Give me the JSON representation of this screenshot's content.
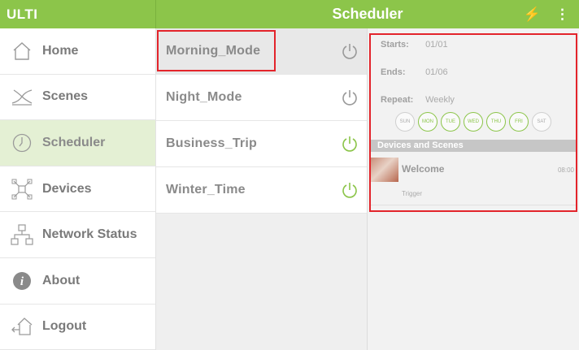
{
  "app": {
    "title": "ULTI"
  },
  "header": {
    "title": "Scheduler",
    "actions": [
      {
        "icon": "lightning-icon",
        "glyph": "⚡"
      },
      {
        "icon": "more-vertical-icon",
        "glyph": "⋮"
      }
    ]
  },
  "sidebar": {
    "items": [
      {
        "label": "Home",
        "icon": "home-icon"
      },
      {
        "label": "Scenes",
        "icon": "scenes-icon"
      },
      {
        "label": "Scheduler",
        "icon": "clock-icon",
        "active": true
      },
      {
        "label": "Devices",
        "icon": "devices-icon"
      },
      {
        "label": "Network Status",
        "icon": "network-icon"
      },
      {
        "label": "About",
        "icon": "info-icon"
      },
      {
        "label": "Logout",
        "icon": "logout-icon"
      }
    ]
  },
  "modes": {
    "items": [
      {
        "label": "Morning_Mode",
        "power": "off",
        "selected": true
      },
      {
        "label": "Night_Mode",
        "power": "off"
      },
      {
        "label": "Business_Trip",
        "power": "on"
      },
      {
        "label": "Winter_Time",
        "power": "on"
      }
    ]
  },
  "detail": {
    "starts_label": "Starts:",
    "starts_value": "01/01",
    "ends_label": "Ends:",
    "ends_value": "01/06",
    "repeat_label": "Repeat:",
    "repeat_value": "Weekly",
    "days": [
      {
        "label": "SUN",
        "on": false
      },
      {
        "label": "MON",
        "on": true
      },
      {
        "label": "TUE",
        "on": true
      },
      {
        "label": "WED",
        "on": true
      },
      {
        "label": "THU",
        "on": true
      },
      {
        "label": "FRI",
        "on": true
      },
      {
        "label": "SAT",
        "on": false
      }
    ],
    "section_title": "Devices and Scenes",
    "scene": {
      "name": "Welcome",
      "time": "08:00",
      "trigger": "Trigger"
    }
  },
  "colors": {
    "accent": "#8cc54a",
    "highlight": "#e3242b",
    "active_nav": "#e4f0d4"
  }
}
